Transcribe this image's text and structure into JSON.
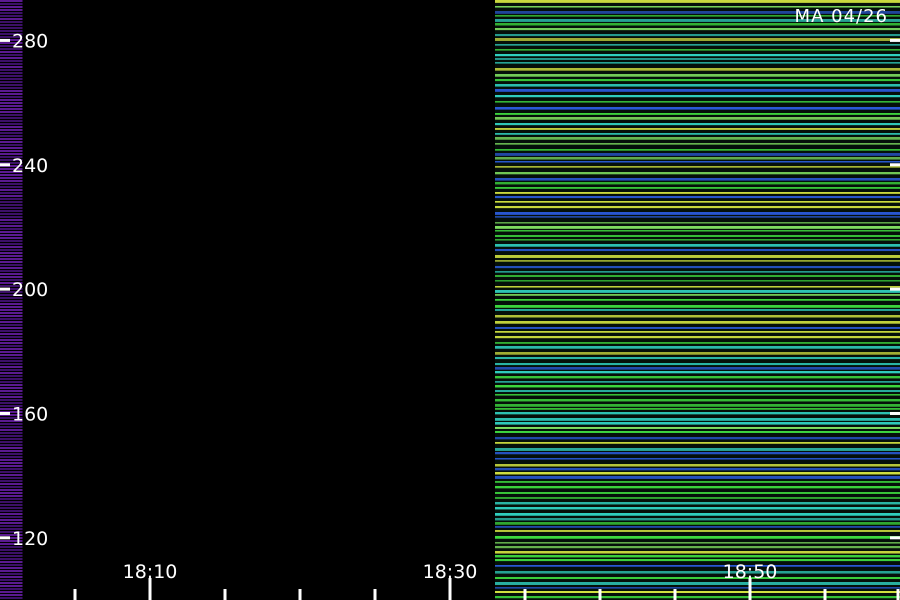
{
  "chart_data": {
    "type": "heatmap",
    "title": "",
    "xlabel": "",
    "ylabel": "",
    "annotation": "MA 04/26",
    "x_ticks": [
      {
        "value": "18:10",
        "labeled": true
      },
      {
        "value": "18:30",
        "labeled": true
      },
      {
        "value": "18:50",
        "labeled": true
      }
    ],
    "x_minor_ticks": [
      "18:05",
      "18:15",
      "18:20",
      "18:25",
      "18:35",
      "18:40",
      "18:45",
      "18:55",
      "19:00"
    ],
    "x_range": [
      "18:00",
      "19:00"
    ],
    "y_ticks": [
      120,
      160,
      200,
      240,
      280
    ],
    "y_range": [
      100,
      293
    ],
    "segments": [
      {
        "x_start": "18:00",
        "x_end": "18:01.5",
        "appearance": "purple banded"
      },
      {
        "x_start": "18:01.5",
        "x_end": "18:33",
        "appearance": "no signal (black)"
      },
      {
        "x_start": "18:33",
        "x_end": "19:00",
        "appearance": "green/cyan/yellow horizontal bands"
      }
    ],
    "colors": {
      "background": "#000000",
      "left_strip": "#5a1a90",
      "band_green": "#40e040",
      "band_cyan": "#30d0c0",
      "band_blue": "#2a5ad8",
      "band_yellow": "#d0e040",
      "tick": "#ffffff"
    }
  }
}
